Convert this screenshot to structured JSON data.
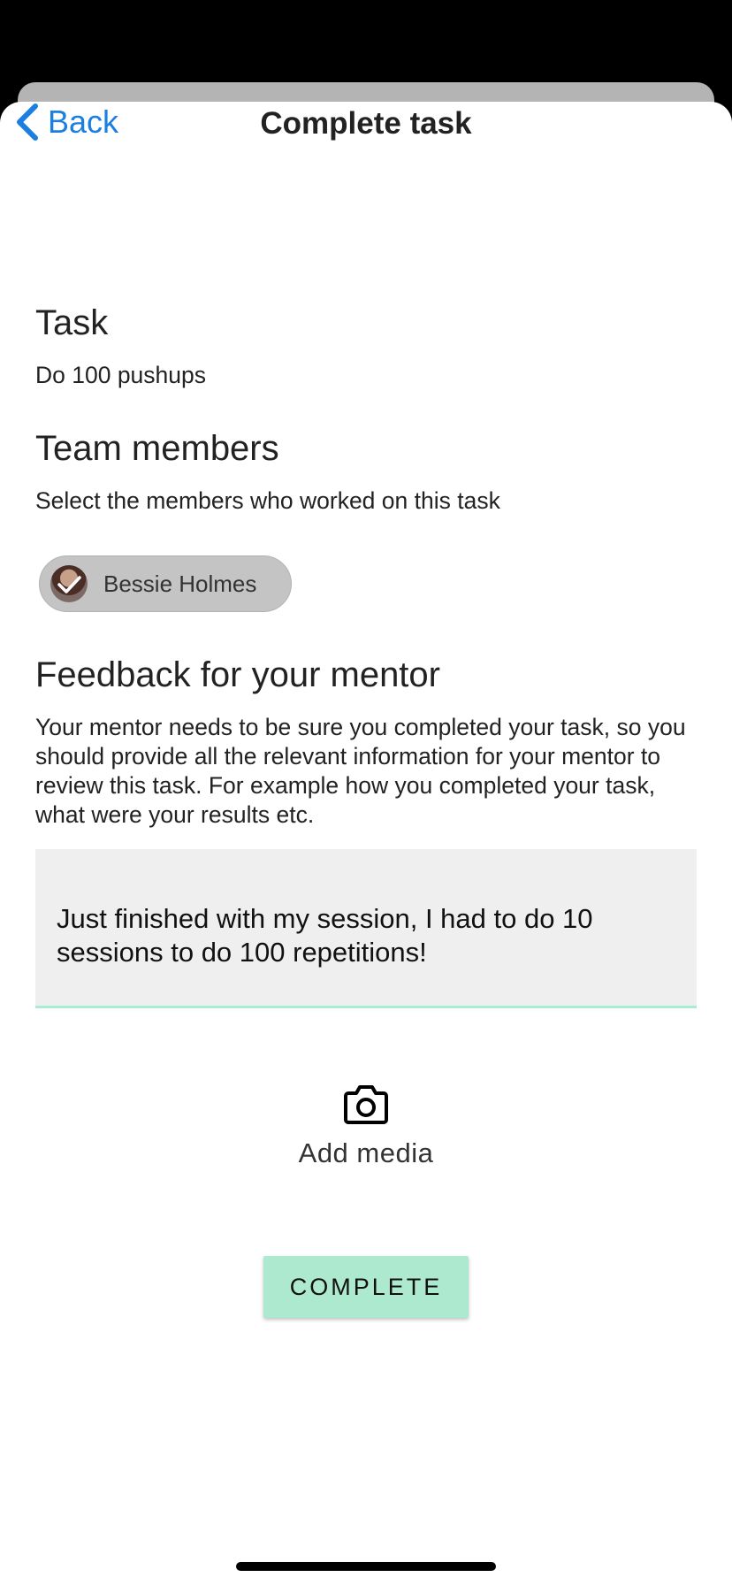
{
  "nav": {
    "back_label": "Back",
    "title": "Complete task"
  },
  "task": {
    "heading": "Task",
    "value": "Do 100 pushups"
  },
  "team": {
    "heading": "Team members",
    "description": "Select the members who worked on this task",
    "members": [
      {
        "name": "Bessie Holmes",
        "selected": true
      }
    ]
  },
  "feedback": {
    "heading": "Feedback for your mentor",
    "description": "Your mentor needs to be sure you completed your task, so you should provide all the relevant information for your mentor to review this task. For example how you completed your task, what were your results etc.",
    "value": "Just finished with my session, I had to do 10 sessions to do 100 repetitions!"
  },
  "media": {
    "label": "Add media",
    "icon": "camera-icon"
  },
  "actions": {
    "complete_label": "COMPLETE"
  },
  "colors": {
    "accent_blue": "#1a7fe0",
    "mint": "#ade9cf",
    "chip_gray": "#c4c4c4",
    "input_bg": "#efefef"
  }
}
